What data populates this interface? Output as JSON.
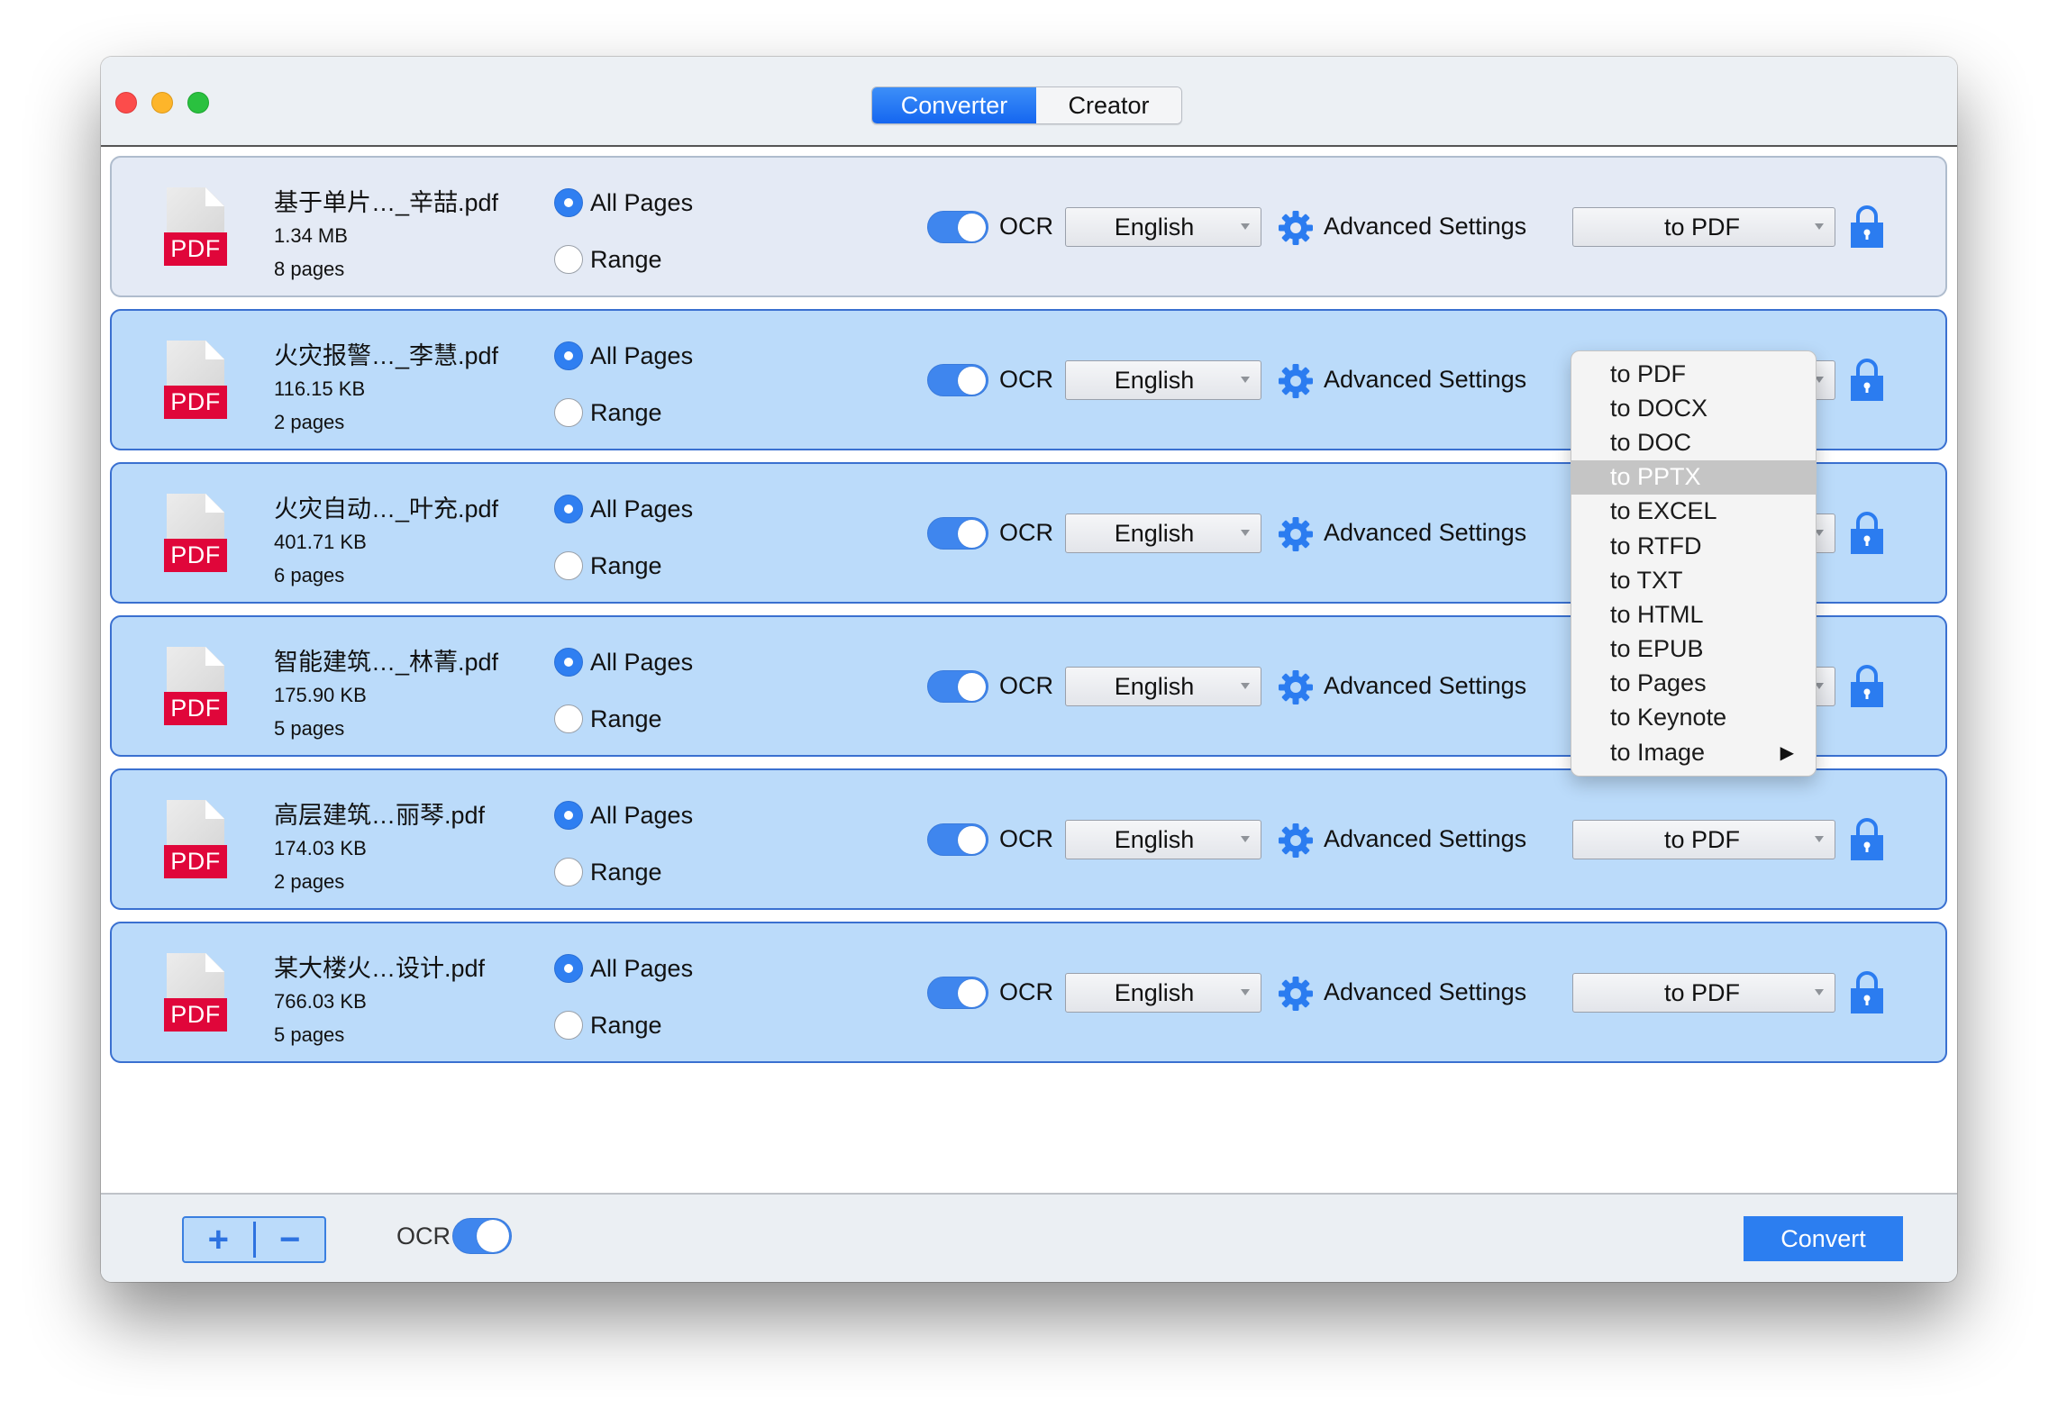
{
  "window": {
    "controls": [
      "close",
      "minimize",
      "zoom"
    ],
    "tabs": [
      {
        "label": "Converter",
        "active": true
      },
      {
        "label": "Creator",
        "active": false
      }
    ]
  },
  "common": {
    "all_pages_label": "All Pages",
    "range_label": "Range",
    "ocr_label": "OCR",
    "advanced_settings_label": "Advanced Settings"
  },
  "files": [
    {
      "name": "基于单片…_辛喆.pdf",
      "size": "1.34 MB",
      "pages": "8 pages",
      "page_mode": "All Pages",
      "ocr": true,
      "language": "English",
      "format": "to PDF",
      "icon_label": "PDF",
      "selected": false
    },
    {
      "name": "火灾报警…_李慧.pdf",
      "size": "116.15 KB",
      "pages": "2 pages",
      "page_mode": "All Pages",
      "ocr": true,
      "language": "English",
      "format": "to PDF",
      "icon_label": "PDF",
      "selected": true
    },
    {
      "name": "火灾自动…_叶充.pdf",
      "size": "401.71 KB",
      "pages": "6 pages",
      "page_mode": "All Pages",
      "ocr": true,
      "language": "English",
      "format": "to PDF",
      "icon_label": "PDF",
      "selected": true
    },
    {
      "name": "智能建筑…_林菁.pdf",
      "size": "175.90 KB",
      "pages": "5 pages",
      "page_mode": "All Pages",
      "ocr": true,
      "language": "English",
      "format": "to PDF",
      "icon_label": "PDF",
      "selected": true
    },
    {
      "name": "高层建筑…丽琴.pdf",
      "size": "174.03 KB",
      "pages": "2 pages",
      "page_mode": "All Pages",
      "ocr": true,
      "language": "English",
      "format": "to PDF",
      "icon_label": "PDF",
      "selected": true
    },
    {
      "name": "某大楼火…设计.pdf",
      "size": "766.03 KB",
      "pages": "5 pages",
      "page_mode": "All Pages",
      "ocr": true,
      "language": "English",
      "format": "to PDF",
      "icon_label": "PDF",
      "selected": true
    }
  ],
  "format_menu": {
    "open_for_row": 2,
    "highlighted": "to PPTX",
    "items": [
      {
        "label": "to PDF"
      },
      {
        "label": "to DOCX"
      },
      {
        "label": "to DOC"
      },
      {
        "label": "to PPTX"
      },
      {
        "label": "to EXCEL"
      },
      {
        "label": "to RTFD"
      },
      {
        "label": "to TXT"
      },
      {
        "label": "to HTML"
      },
      {
        "label": "to EPUB"
      },
      {
        "label": "to Pages"
      },
      {
        "label": "to Keynote"
      },
      {
        "label": "to Image",
        "submenu": true,
        "submenu_glyph": "▶"
      }
    ]
  },
  "footer": {
    "add_glyph": "+",
    "remove_glyph": "−",
    "ocr_label": "OCR",
    "ocr_on": true,
    "convert_label": "Convert"
  },
  "colors": {
    "accent": "#2c7ef0",
    "row_selected_bg": "#bbdbfa",
    "row_unselected_bg": "#e4eaf5",
    "pdf_red": "#e0063a"
  }
}
